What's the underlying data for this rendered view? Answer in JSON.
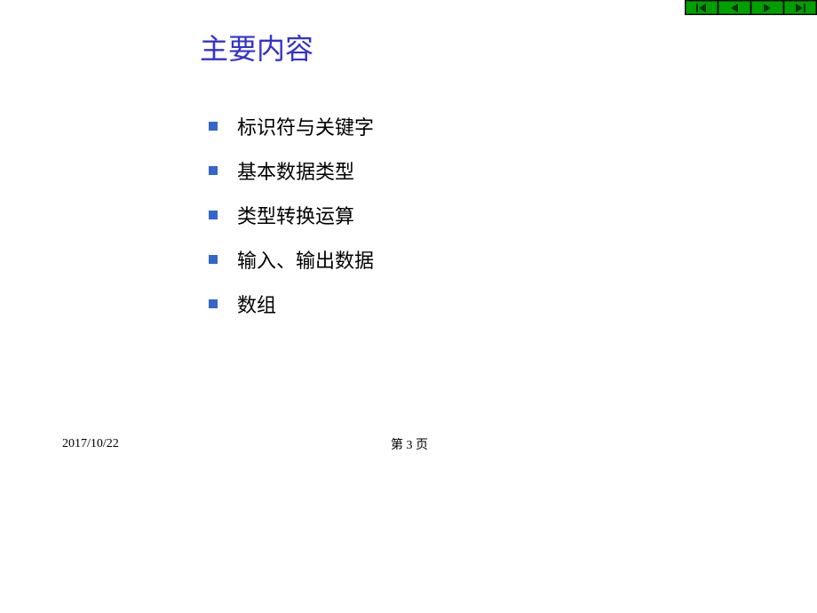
{
  "nav": {
    "first": "first-button",
    "prev": "prev-button",
    "next": "next-button",
    "last": "last-button"
  },
  "slide": {
    "title": "主要内容",
    "bullets": [
      "标识符与关键字",
      "基本数据类型",
      "类型转换运算",
      "输入、输出数据",
      "数组"
    ]
  },
  "footer": {
    "date": "2017/10/22",
    "page": "第 3 页"
  }
}
